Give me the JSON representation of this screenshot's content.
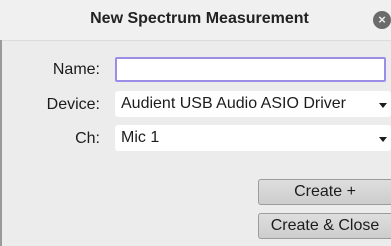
{
  "dialog": {
    "title": "New Spectrum Measurement",
    "close_symbol": "×"
  },
  "form": {
    "name_label": "Name:",
    "name_value": "",
    "name_placeholder": "",
    "device_label": "Device:",
    "device_value": "Audient USB Audio ASIO Driver",
    "channel_label": "Ch:",
    "channel_value": "Mic 1"
  },
  "buttons": {
    "create": "Create +",
    "create_close": "Create & Close"
  },
  "icons": {
    "close": "close-icon",
    "dropdown": "chevron-down-icon"
  },
  "colors": {
    "input_focus_border": "#9a8ee8",
    "background": "#ececec"
  }
}
